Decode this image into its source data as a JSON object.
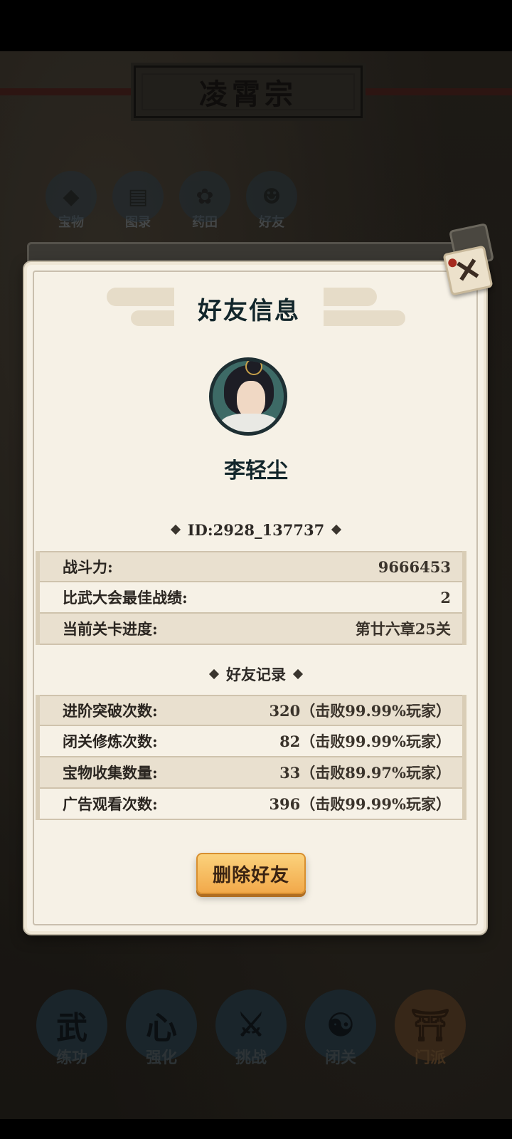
{
  "background": {
    "sect_title": "凌霄宗",
    "features": [
      {
        "label": "宝物",
        "icon": "treasure-icon"
      },
      {
        "label": "图录",
        "icon": "catalog-icon"
      },
      {
        "label": "药田",
        "icon": "herb-field-icon"
      },
      {
        "label": "好友",
        "icon": "friends-icon"
      }
    ],
    "nav": [
      {
        "label": "练功",
        "icon": "practice-icon",
        "glyph": "武"
      },
      {
        "label": "强化",
        "icon": "heart-icon",
        "glyph": "心"
      },
      {
        "label": "挑战",
        "icon": "swords-icon",
        "glyph": "⚔"
      },
      {
        "label": "闭关",
        "icon": "seclusion-icon",
        "glyph": "☯"
      },
      {
        "label": "门派",
        "icon": "sect-gate-icon",
        "glyph": "⛩"
      }
    ],
    "active_nav": "门派"
  },
  "dialog": {
    "title": "好友信息",
    "close_glyph": "✕",
    "player_name": "李轻尘",
    "id_label": "ID:",
    "id_value": "2928_137737",
    "stats": [
      {
        "label": "战斗力:",
        "value": "9666453"
      },
      {
        "label": "比武大会最佳战绩:",
        "value": "2"
      },
      {
        "label": "当前关卡进度:",
        "value": "第廿六章25关"
      }
    ],
    "records_title": "好友记录",
    "records": [
      {
        "label": "进阶突破次数:",
        "value": "320（击败99.99%玩家）"
      },
      {
        "label": "闭关修炼次数:",
        "value": "82（击败99.99%玩家）"
      },
      {
        "label": "宝物收集数量:",
        "value": "33（击败89.97%玩家）"
      },
      {
        "label": "广告观看次数:",
        "value": "396（击败99.99%玩家）"
      }
    ],
    "delete_label": "删除好友"
  },
  "colors": {
    "panel": "#f6f1e6",
    "title_text": "#12262b",
    "button_orange": "#f2a94a"
  }
}
